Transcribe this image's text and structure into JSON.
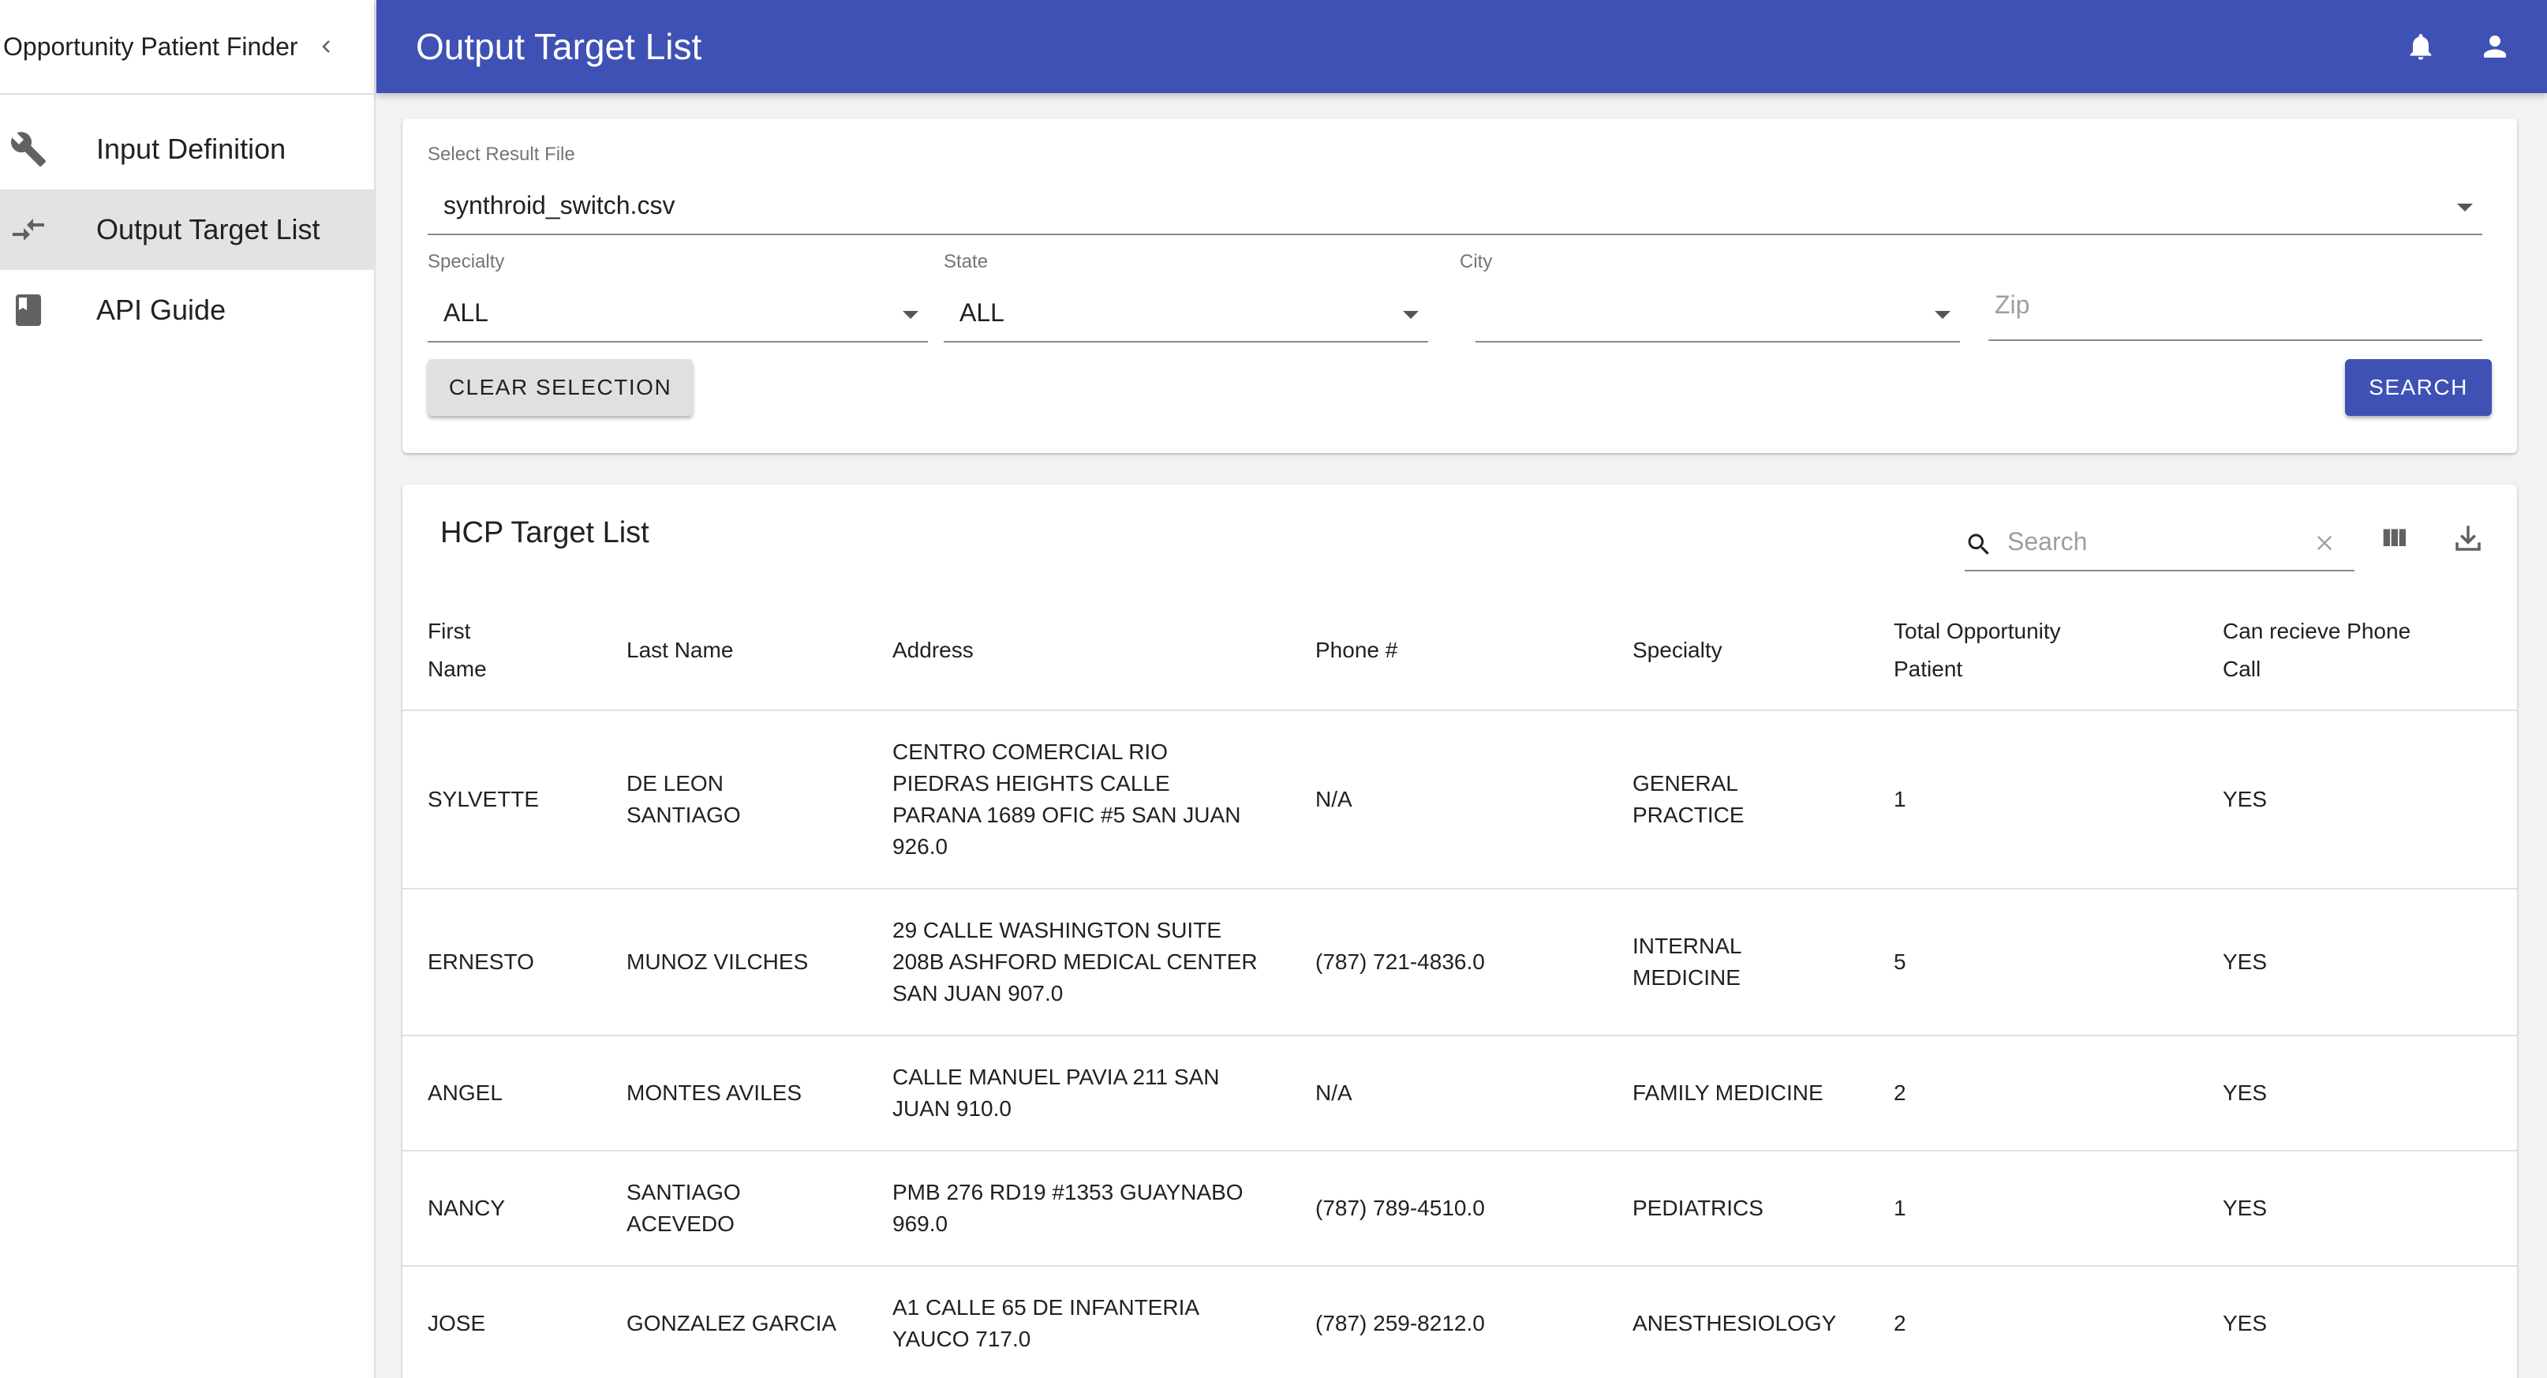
{
  "sidebar": {
    "title": "Opportunity Patient Finder",
    "items": [
      {
        "label": "Input Definition",
        "icon": "wrench-icon"
      },
      {
        "label": "Output Target List",
        "icon": "compare-arrows-icon",
        "active": true
      },
      {
        "label": "API Guide",
        "icon": "book-icon"
      }
    ]
  },
  "appbar": {
    "title": "Output Target List",
    "icons": [
      "bell-icon",
      "account-icon"
    ]
  },
  "filters": {
    "result_file": {
      "label": "Select Result File",
      "value": "synthroid_switch.csv"
    },
    "specialty": {
      "label": "Specialty",
      "value": "ALL"
    },
    "state": {
      "label": "State",
      "value": "ALL"
    },
    "city": {
      "label": "City",
      "value": ""
    },
    "zip": {
      "placeholder": "Zip"
    },
    "clear_label": "CLEAR SELECTION",
    "search_label": "SEARCH"
  },
  "table": {
    "title": "HCP Target List",
    "search_placeholder": "Search",
    "columns": [
      "First Name",
      "Last Name",
      "Address",
      "Phone #",
      "Specialty",
      "Total Opportunity Patient",
      "Can recieve Phone Call"
    ],
    "rows": [
      [
        "SYLVETTE",
        "DE LEON SANTIAGO",
        "CENTRO COMERCIAL RIO PIEDRAS HEIGHTS CALLE PARANA 1689 OFIC #5 SAN JUAN 926.0",
        "N/A",
        "GENERAL PRACTICE",
        "1",
        "YES"
      ],
      [
        "ERNESTO",
        "MUNOZ VILCHES",
        "29 CALLE WASHINGTON SUITE 208B ASHFORD MEDICAL CENTER SAN JUAN 907.0",
        "(787) 721-4836.0",
        "INTERNAL MEDICINE",
        "5",
        "YES"
      ],
      [
        "ANGEL",
        "MONTES AVILES",
        "CALLE MANUEL PAVIA 211 SAN JUAN 910.0",
        "N/A",
        "FAMILY MEDICINE",
        "2",
        "YES"
      ],
      [
        "NANCY",
        "SANTIAGO ACEVEDO",
        "PMB 276 RD19 #1353 GUAYNABO 969.0",
        "(787) 789-4510.0",
        "PEDIATRICS",
        "1",
        "YES"
      ],
      [
        "JOSE",
        "GONZALEZ GARCIA",
        "A1 CALLE 65 DE INFANTERIA YAUCO 717.0",
        "(787) 259-8212.0",
        "ANESTHESIOLOGY",
        "2",
        "YES"
      ]
    ]
  },
  "colors": {
    "primary": "#3f51b5",
    "active_nav": "#e3e3e3"
  }
}
